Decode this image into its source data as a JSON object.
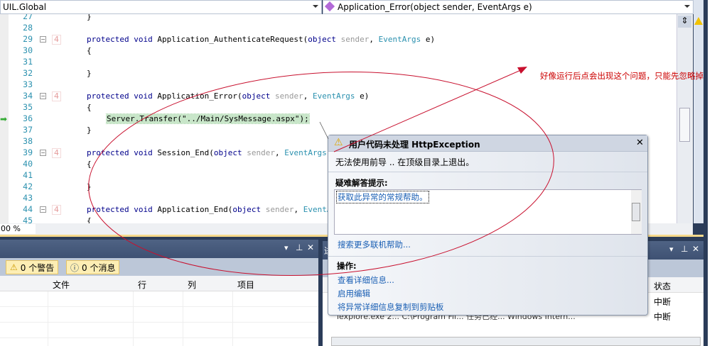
{
  "topbar": {
    "class_dropdown": "UIL.Global",
    "member_dropdown": "Application_Error(object sender, EventArgs e)"
  },
  "editor": {
    "lines": [
      {
        "n": "27",
        "text": "}"
      },
      {
        "n": "28",
        "text": ""
      },
      {
        "n": "29",
        "text": "protected void Application_AuthenticateRequest(object sender, EventArgs e)",
        "refs": "4"
      },
      {
        "n": "30",
        "text": "{"
      },
      {
        "n": "31",
        "text": ""
      },
      {
        "n": "32",
        "text": "}"
      },
      {
        "n": "33",
        "text": ""
      },
      {
        "n": "34",
        "text": "protected void Application_Error(object sender, EventArgs e)",
        "refs": "4"
      },
      {
        "n": "35",
        "text": "{"
      },
      {
        "n": "36",
        "text": "Server.Transfer(\"../Main/SysMessage.aspx\");"
      },
      {
        "n": "37",
        "text": "}"
      },
      {
        "n": "38",
        "text": ""
      },
      {
        "n": "39",
        "text": "protected void Session_End(object sender, EventArgs e)",
        "refs": "4"
      },
      {
        "n": "40",
        "text": "{"
      },
      {
        "n": "41",
        "text": ""
      },
      {
        "n": "42",
        "text": "}"
      },
      {
        "n": "43",
        "text": ""
      },
      {
        "n": "44",
        "text": "protected void Application_End(object sender, EventArgs e)",
        "refs": "4"
      },
      {
        "n": "45",
        "text": "{"
      }
    ],
    "zoom": "00 %"
  },
  "annotation": {
    "text": "好像运行后点会出现这个问题，只能先忽略掉",
    "color": "#cc0000"
  },
  "error_list": {
    "warnings": "0 个警告",
    "messages": "0 个消息",
    "columns": [
      "文件",
      "行",
      "列",
      "项目"
    ]
  },
  "right_panel": {
    "title_partial": "进",
    "status_header": "状态",
    "rows": [
      {
        "status": "中断"
      },
      {
        "status": "中断",
        "partial": "iexplore.exe     2... C:\\Program Fil...  任务已经...  Windows Intern..."
      }
    ]
  },
  "exception_dialog": {
    "title": "用户代码未处理 HttpException",
    "message": "无法使用前导 .. 在顶级目录上退出。",
    "tips_header": "疑难解答提示:",
    "tip_link": "获取此异常的常规帮助。",
    "search_link": "搜索更多联机帮助...",
    "actions_header": "操作:",
    "actions": [
      "查看详细信息...",
      "启用编辑",
      "将异常详细信息复制到剪贴板"
    ]
  }
}
